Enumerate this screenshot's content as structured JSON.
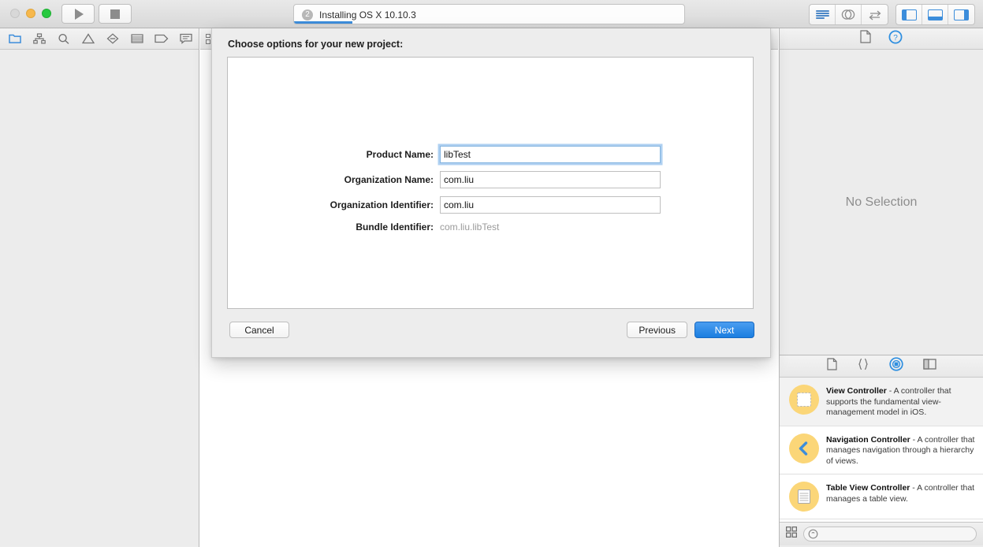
{
  "window": {
    "titlebar": {
      "traffic_lights": [
        "close",
        "minimize",
        "zoom"
      ],
      "run_button": "run-button",
      "stop_button": "stop-button",
      "status": {
        "badge_count": "2",
        "text": "Installing OS X 10.10.3",
        "progress_percent": 15
      },
      "editor_segment": [
        "standard-editor",
        "assistant-editor",
        "version-editor"
      ],
      "view_segment": [
        "navigator-toggle",
        "debug-area-toggle",
        "utilities-toggle"
      ]
    }
  },
  "navigator": {
    "tabs": [
      {
        "name": "project-navigator",
        "icon": "folder-icon",
        "selected": true
      },
      {
        "name": "symbol-navigator",
        "icon": "hierarchy-icon",
        "selected": false
      },
      {
        "name": "find-navigator",
        "icon": "search-icon",
        "selected": false
      },
      {
        "name": "issue-navigator",
        "icon": "warning-triangle-icon",
        "selected": false
      },
      {
        "name": "test-navigator",
        "icon": "diamond-icon",
        "selected": false
      },
      {
        "name": "debug-navigator",
        "icon": "list-icon",
        "selected": false
      },
      {
        "name": "breakpoint-navigator",
        "icon": "tag-icon",
        "selected": false
      },
      {
        "name": "report-navigator",
        "icon": "speech-bubble-icon",
        "selected": false
      }
    ]
  },
  "editor": {
    "jumpbar_icon": "related-items-icon"
  },
  "inspector": {
    "tabs": [
      {
        "name": "file-inspector",
        "icon": "document-icon",
        "selected": false
      },
      {
        "name": "quick-help-inspector",
        "icon": "help-circle-icon",
        "selected": true
      }
    ],
    "empty_message": "No Selection",
    "library_tabs": [
      {
        "name": "file-template-library",
        "icon": "document-icon",
        "selected": false
      },
      {
        "name": "code-snippet-library",
        "icon": "braces-icon",
        "selected": false
      },
      {
        "name": "object-library",
        "icon": "object-circle-icon",
        "selected": true
      },
      {
        "name": "media-library",
        "icon": "media-panel-icon",
        "selected": false
      }
    ],
    "library_items": [
      {
        "icon": "view-controller-icon",
        "title": "View Controller",
        "description": " - A controller that supports the fundamental view-management model in iOS."
      },
      {
        "icon": "navigation-controller-icon",
        "title": "Navigation Controller",
        "description": " - A controller that manages navigation through a hierarchy of views."
      },
      {
        "icon": "table-view-controller-icon",
        "title": "Table View Controller",
        "description": " - A controller that manages a table view."
      }
    ],
    "bottom_bar": {
      "layout_icon": "grid-view-icon",
      "search_icon": "search-icon",
      "search_placeholder": ""
    }
  },
  "sheet": {
    "title": "Choose options for your new project:",
    "fields": [
      {
        "label": "Product Name:",
        "value": "libTest",
        "focused": true,
        "readonly": false
      },
      {
        "label": "Organization Name:",
        "value": "com.liu",
        "focused": false,
        "readonly": false
      },
      {
        "label": "Organization Identifier:",
        "value": "com.liu",
        "focused": false,
        "readonly": false
      },
      {
        "label": "Bundle Identifier:",
        "value": "com.liu.libTest",
        "focused": false,
        "readonly": true
      }
    ],
    "buttons": {
      "cancel": "Cancel",
      "previous": "Previous",
      "next": "Next"
    }
  },
  "colors": {
    "accent_blue": "#3c8ddb",
    "primary_button": "#1b7ee0",
    "library_icon": "#fbd678",
    "focus_ring": "#6eaae6"
  }
}
